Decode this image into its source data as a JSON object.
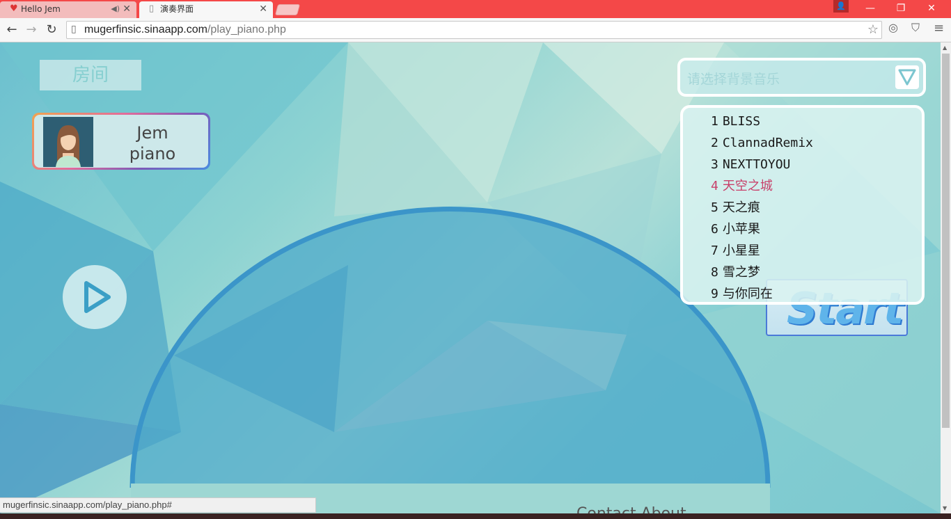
{
  "browser": {
    "tabs": [
      {
        "title": "Hello Jem",
        "icon": "heart-icon"
      },
      {
        "title": "演奏界面",
        "icon": "page-icon"
      }
    ],
    "url_host": "mugerfinsic.sinaapp.com",
    "url_path": "/play_piano.php",
    "status_url": "mugerfinsic.sinaapp.com/play_piano.php#"
  },
  "page": {
    "room_label": "房间",
    "user": {
      "name": "Jem",
      "instrument": "piano"
    },
    "bg_music_placeholder": "请选择背景音乐",
    "start_label": "Start",
    "music_list": [
      {
        "num": "1",
        "title": "BLISS"
      },
      {
        "num": "2",
        "title": "ClannadRemix"
      },
      {
        "num": "3",
        "title": "NEXTTOYOU"
      },
      {
        "num": "4",
        "title": "天空之城",
        "active": true
      },
      {
        "num": "5",
        "title": "天之痕"
      },
      {
        "num": "6",
        "title": "小苹果"
      },
      {
        "num": "7",
        "title": "小星星"
      },
      {
        "num": "8",
        "title": "雪之梦"
      },
      {
        "num": "9",
        "title": "与你同在"
      }
    ],
    "footer": "Contact    About"
  },
  "colors": {
    "titlebar": "#f44848",
    "active_song": "#c8406a",
    "start_blue": "#5fb4ea"
  }
}
